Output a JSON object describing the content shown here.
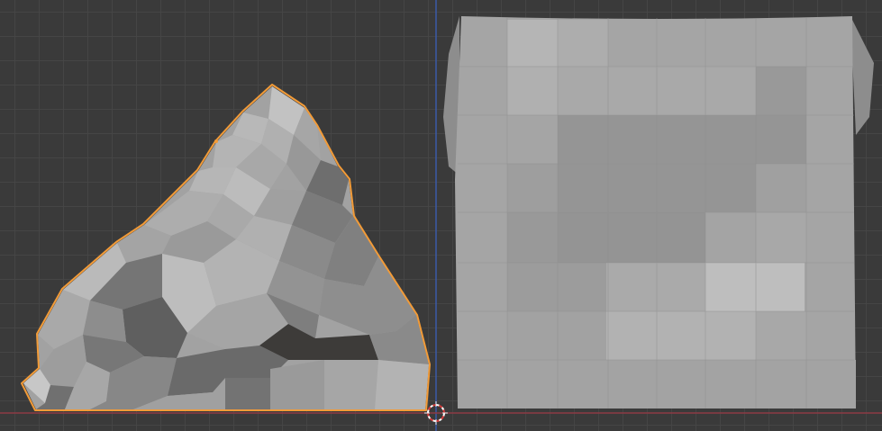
{
  "app": {
    "view": "3D Viewport"
  },
  "colors": {
    "background": "#3a3a3a",
    "grid_line": "#464646",
    "x_axis": "#8c3a45",
    "z_axis": "#3b5aa8",
    "selection_outline": "#f29b38",
    "mesh_light": "#b9b9b9",
    "mesh_mid": "#9c9c9c",
    "mesh_dark": "#6f6f6f",
    "mesh_shadow": "#3b3a38"
  },
  "objects": [
    {
      "name": "sculpted-mesh",
      "selected": true
    },
    {
      "name": "cube-mesh",
      "selected": false
    }
  ],
  "cursor": {
    "icon": "3d-cursor-icon"
  }
}
